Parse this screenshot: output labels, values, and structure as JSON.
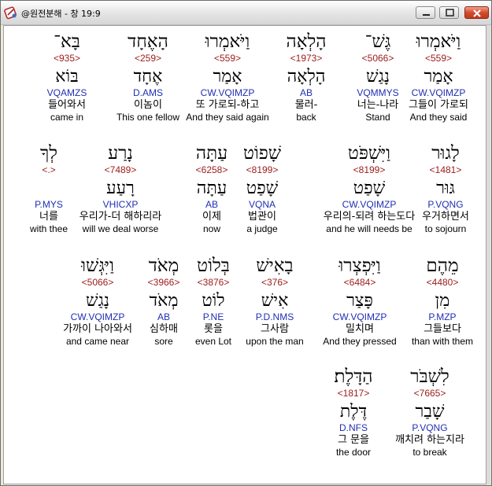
{
  "window": {
    "title": "@원전분해 - 창 19:9",
    "minimize_label": "minimize",
    "maximize_label": "maximize",
    "close_label": "close"
  },
  "rows": [
    [
      {
        "heb": "וַיֹּאמְרוּ",
        "strong": "<559>",
        "lemma": "אָמַר",
        "parse": "CW.VQIMZP",
        "kor": "그들이 가로되",
        "eng": "And they said",
        "selected": true
      },
      {
        "heb": "גֶּשׁ־",
        "strong": "<5066>",
        "lemma": "נָגַשׁ",
        "parse": "VQMMYS",
        "kor": "너는-나라",
        "eng": "Stand"
      },
      {
        "heb": "הָלְאָה",
        "strong": "<1973>",
        "lemma": "הָלְאָה",
        "parse": "AB",
        "kor": "물러-",
        "eng": "back"
      },
      {
        "heb": "וַיֹּאמְרוּ",
        "strong": "<559>",
        "lemma": "אָמַר",
        "parse": "CW.VQIMZP",
        "kor": "또 가로되-하고",
        "eng": "And they said again"
      },
      {
        "heb": "הָאֶחָד",
        "strong": "<259>",
        "lemma": "אֶחָד",
        "parse": "D.AMS",
        "kor": "이놈이",
        "eng": "This one fellow"
      },
      {
        "heb": "בָּא־",
        "strong": "<935>",
        "lemma": "בּוֹא",
        "parse": "VQAMZS",
        "kor": "들어와서",
        "eng": "came in"
      }
    ],
    [
      {
        "heb": "לָגוּר",
        "strong": "<1481>",
        "lemma": "גּוּר",
        "parse": "P.VQNG",
        "kor": "우거하면서",
        "eng": "to sojourn"
      },
      {
        "heb": "וַיִּשְׁפֹּט",
        "strong": "<8199>",
        "lemma": "שָׁפַט",
        "parse": "CW.VQIMZP",
        "kor": "우리의-되려 하는도다",
        "eng": "and he will needs be"
      },
      {
        "heb": "שָׁפוֹט",
        "strong": "<8199>",
        "lemma": "שָׁפַט",
        "parse": "VQNA",
        "kor": "법관이",
        "eng": "a judge"
      },
      {
        "heb": "עַתָּה",
        "strong": "<6258>",
        "lemma": "עַתָּה",
        "parse": "AB",
        "kor": "이제",
        "eng": "now"
      },
      {
        "heb": "נָרַע",
        "strong": "<7489>",
        "lemma": "רָעַע",
        "parse": "VHICXP",
        "kor": "우리가-더 해하리라",
        "eng": "will we deal worse"
      },
      {
        "heb": "לְךָ",
        "strong": "<.>",
        "lemma": "",
        "parse": "P.MYS",
        "kor": "너를",
        "eng": "with thee"
      }
    ],
    [
      {
        "heb": "מֵהֶם",
        "strong": "<4480>",
        "lemma": "מִן",
        "parse": "P.MZP",
        "kor": "그들보다",
        "eng": "than with them"
      },
      {
        "heb": "וַיִּפְצְרוּ",
        "strong": "<6484>",
        "lemma": "פָּצַר",
        "parse": "CW.VQIMZP",
        "kor": "밀치며",
        "eng": "And they pressed"
      },
      {
        "heb": "בָאִישׁ",
        "strong": "<376>",
        "lemma": "אִישׁ",
        "parse": "P.D.NMS",
        "kor": "그사람",
        "eng": "upon the man"
      },
      {
        "heb": "בְּלוֹט",
        "strong": "<3876>",
        "lemma": "לוֹט",
        "parse": "P.NE",
        "kor": "롯을",
        "eng": "even Lot"
      },
      {
        "heb": "מְאֹד",
        "strong": "<3966>",
        "lemma": "מְאֹד",
        "parse": "AB",
        "kor": "심하매",
        "eng": "sore"
      },
      {
        "heb": "וַיִּגְּשׁוּ",
        "strong": "<5066>",
        "lemma": "נָגַשׁ",
        "parse": "CW.VQIMZP",
        "kor": "가까이 나아와서",
        "eng": "and came near"
      }
    ],
    [
      {
        "heb": "לִשְׁבֹּר",
        "strong": "<7665>",
        "lemma": "שָׁבַר",
        "parse": "P.VQNG",
        "kor": "깨치려 하는지라",
        "eng": "to break"
      },
      {
        "heb": "הַדָּלֶת׃",
        "strong": "<1817>",
        "lemma": "דֶּלֶת",
        "parse": "D.NFS",
        "kor": "그 문을",
        "eng": "the door"
      }
    ]
  ]
}
